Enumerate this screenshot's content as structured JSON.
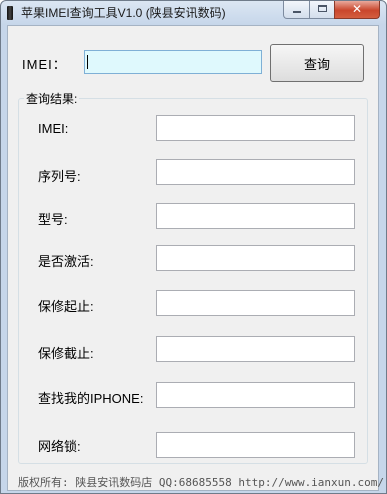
{
  "window": {
    "title": "苹果IMEI查询工具V1.0 (陕县安讯数码)",
    "close_glyph": "✕"
  },
  "query": {
    "imei_label": "IMEI：",
    "imei_value": "",
    "button_label": "查询"
  },
  "results": {
    "group_title": "查询结果:",
    "fields": [
      {
        "label": "IMEI:",
        "value": ""
      },
      {
        "label": "序列号:",
        "value": ""
      },
      {
        "label": "型号:",
        "value": ""
      },
      {
        "label": "是否激活:",
        "value": ""
      },
      {
        "label": "保修起止:",
        "value": ""
      },
      {
        "label": "保修截止:",
        "value": ""
      },
      {
        "label": "查找我的IPHONE:",
        "value": ""
      },
      {
        "label": "网络锁:",
        "value": ""
      }
    ]
  },
  "footer": {
    "text": "版权所有: 陕县安讯数码店 QQ:68685558 http://www.ianxun.com/"
  }
}
